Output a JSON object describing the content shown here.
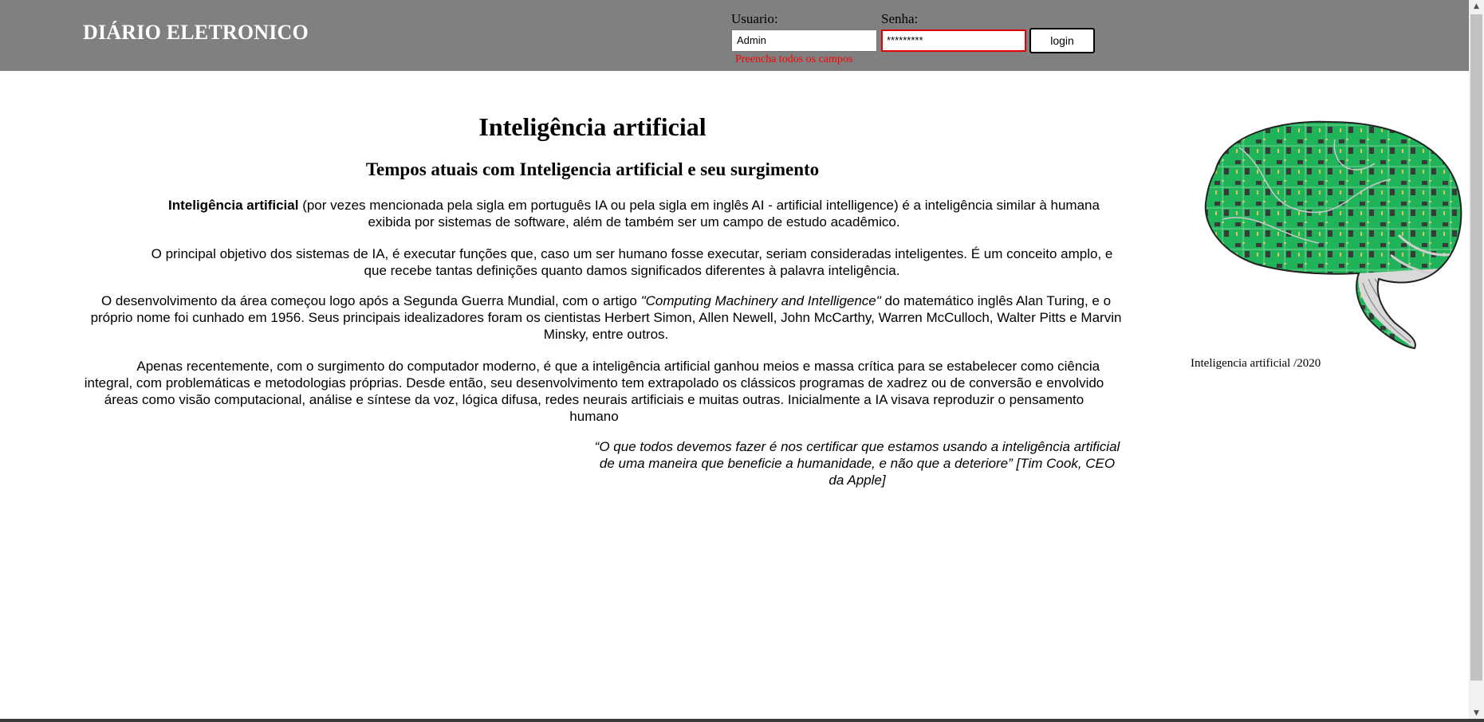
{
  "header": {
    "brand": "DIÁRIO ELETRONICO",
    "user_label": "Usuario:",
    "user_value": "Admin",
    "password_label": "Senha:",
    "password_value": "*********",
    "login_button": "login",
    "error_message": "Preencha todos os campos"
  },
  "article": {
    "title": "Inteligência artificial",
    "subtitle": "Tempos atuais com Inteligencia artificial e seu surgimento",
    "p1_bold": "Inteligência artificial",
    "p1_rest": " (por vezes mencionada pela sigla em português IA ou pela sigla em inglês AI - artificial intelligence) é a inteligência similar à humana exibida por sistemas de software, além de também ser um campo de estudo acadêmico.",
    "p2": "O principal objetivo dos sistemas de IA, é executar funções que, caso um ser humano fosse executar, seriam consideradas inteligentes. É um conceito amplo, e que recebe tantas definições quanto damos significados diferentes à palavra inteligência.",
    "p3_a": "O desenvolvimento da área começou logo após a Segunda Guerra Mundial, com o artigo ",
    "p3_italic": "\"Computing Machinery and Intelligence\"",
    "p3_b": " do matemático inglês Alan Turing, e o próprio nome foi cunhado em 1956. Seus principais idealizadores foram os cientistas Herbert Simon, Allen Newell, John McCarthy, Warren McCulloch, Walter Pitts e Marvin Minsky, entre outros.",
    "p4": "Apenas recentemente, com o surgimento do computador moderno, é que a inteligência artificial ganhou meios e massa crítica para se estabelecer como ciência integral, com problemáticas e metodologias próprias. Desde então, seu desenvolvimento tem extrapolado os clássicos programas de xadrez ou de conversão e envolvido áreas como visão computacional, análise e síntese da voz, lógica difusa, redes neurais artificiais e muitas outras. Inicialmente a IA visava reproduzir o pensamento humano",
    "quote": "“O que todos devemos fazer é nos certificar que estamos usando a inteligência artificial de uma maneira que beneficie a humanidade, e não que a deteriore” [Tim Cook, CEO da Apple]"
  },
  "figure": {
    "caption": "Inteligencia artificial /2020",
    "icon": "circuit-brain-illustration"
  },
  "colors": {
    "header_bg": "#808080",
    "error": "#ff0000",
    "circuit_green": "#1fb35a"
  }
}
